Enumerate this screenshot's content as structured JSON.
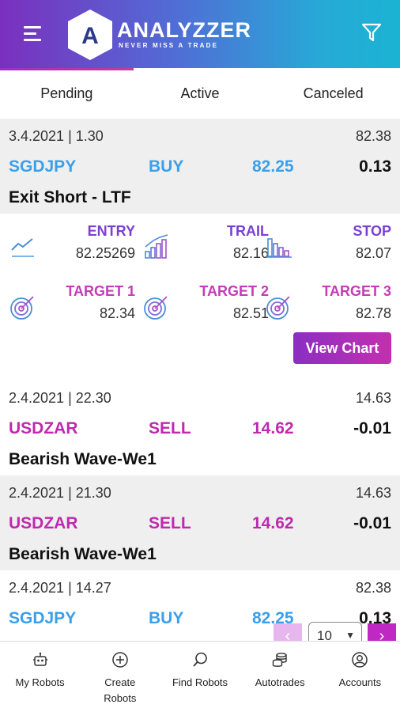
{
  "header": {
    "logo_letter": "A",
    "brand": "ANALYZZER",
    "tagline": "NEVER MISS A TRADE",
    "menu_icon": "hamburger-icon",
    "filter_icon": "filter-icon"
  },
  "tabs": [
    {
      "label": "Pending",
      "active": true
    },
    {
      "label": "Active",
      "active": false
    },
    {
      "label": "Canceled",
      "active": false
    }
  ],
  "trades": [
    {
      "date": "3.4.2021 | 1.30",
      "ref_price": "82.38",
      "symbol": "SGDJPY",
      "side": "BUY",
      "price": "82.25",
      "pnl": "0.13",
      "strategy": "Exit Short - LTF",
      "details": {
        "entry_label": "ENTRY",
        "entry": "82.25269",
        "trail_label": "TRAIL",
        "trail": "82.16",
        "stop_label": "STOP",
        "stop": "82.07",
        "t1_label": "TARGET 1",
        "t1": "82.34",
        "t2_label": "TARGET 2",
        "t2": "82.51",
        "t3_label": "TARGET 3",
        "t3": "82.78"
      },
      "view_chart": "View Chart"
    },
    {
      "date": "2.4.2021 | 22.30",
      "ref_price": "14.63",
      "symbol": "USDZAR",
      "side": "SELL",
      "price": "14.62",
      "pnl": "-0.01",
      "strategy": "Bearish Wave-We1"
    },
    {
      "date": "2.4.2021 | 21.30",
      "ref_price": "14.63",
      "symbol": "USDZAR",
      "side": "SELL",
      "price": "14.62",
      "pnl": "-0.01",
      "strategy": "Bearish Wave-We1"
    },
    {
      "date": "2.4.2021 | 14.27",
      "ref_price": "82.38",
      "symbol": "SGDJPY",
      "side": "BUY",
      "price": "82.25",
      "pnl": "0.13"
    }
  ],
  "pager": {
    "prev": "‹",
    "page_size": "10",
    "next": "›"
  },
  "nav": [
    {
      "label": "My Robots",
      "icon": "robot-icon"
    },
    {
      "label": "Create Robots",
      "icon": "plus-circle-icon"
    },
    {
      "label": "Find Robots",
      "icon": "search-icon"
    },
    {
      "label": "Autotrades",
      "icon": "coins-icon"
    },
    {
      "label": "Accounts",
      "icon": "user-circle-icon"
    }
  ],
  "colors": {
    "buy": "#3aa0ea",
    "sell": "#c028b0",
    "accent": "#c028c4"
  }
}
